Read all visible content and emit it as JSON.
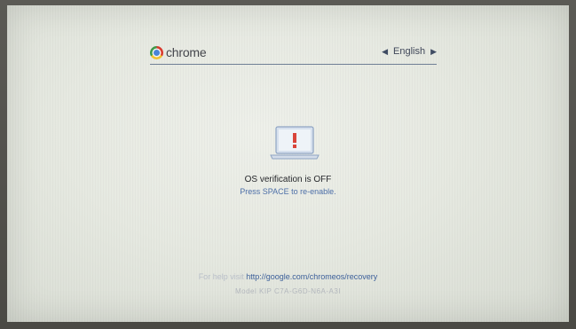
{
  "brand": {
    "name": "chrome",
    "icon": "chrome-logo-icon"
  },
  "language": {
    "selected": "English",
    "prev_icon": "arrow-left-icon",
    "next_icon": "arrow-right-icon"
  },
  "status": {
    "icon": "laptop-warning-icon",
    "title": "OS verification is OFF",
    "instruction": "Press SPACE to re-enable."
  },
  "help": {
    "prefix": "For help visit",
    "link": "http://google.com/chromeos/recovery"
  },
  "model": {
    "text": "Model KIP C7A-G6D-N6A-A3I"
  },
  "colors": {
    "accent": "#3c5f9a",
    "warning": "#d9443a",
    "background": "#e9ece5"
  }
}
